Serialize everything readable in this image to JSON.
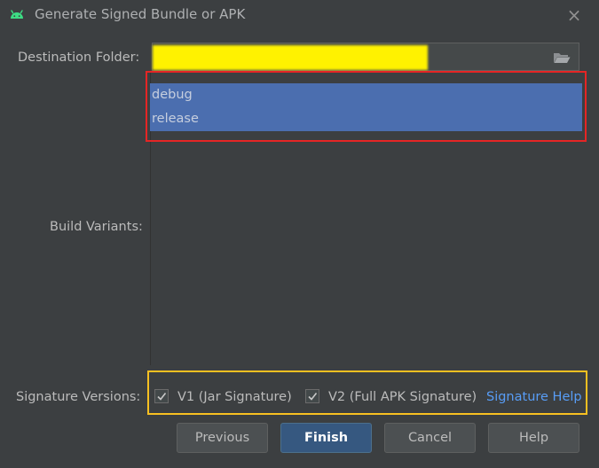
{
  "window": {
    "title": "Generate Signed Bundle or APK",
    "icon": "android-icon",
    "close_icon": "close-icon"
  },
  "form": {
    "destination_label": "Destination Folder:",
    "destination_value": "",
    "browse_icon": "folder-open-icon",
    "build_variants_label": "Build Variants:",
    "build_variants": [
      {
        "label": "debug",
        "selected": true
      },
      {
        "label": "release",
        "selected": true
      }
    ],
    "signature_versions_label": "Signature Versions:",
    "signature_options": [
      {
        "label": "V1 (Jar Signature)",
        "checked": true
      },
      {
        "label": "V2 (Full APK Signature)",
        "checked": true
      }
    ],
    "signature_help": "Signature Help"
  },
  "buttons": {
    "previous": "Previous",
    "finish": "Finish",
    "cancel": "Cancel",
    "help": "Help"
  },
  "annotations": {
    "red_box_color": "#e52525",
    "orange_box_color": "#f8c021",
    "redaction_color": "#fff200"
  },
  "colors": {
    "background": "#3c3f41",
    "selection": "#4b6eaf",
    "link": "#589df6",
    "default_button": "#365880"
  }
}
